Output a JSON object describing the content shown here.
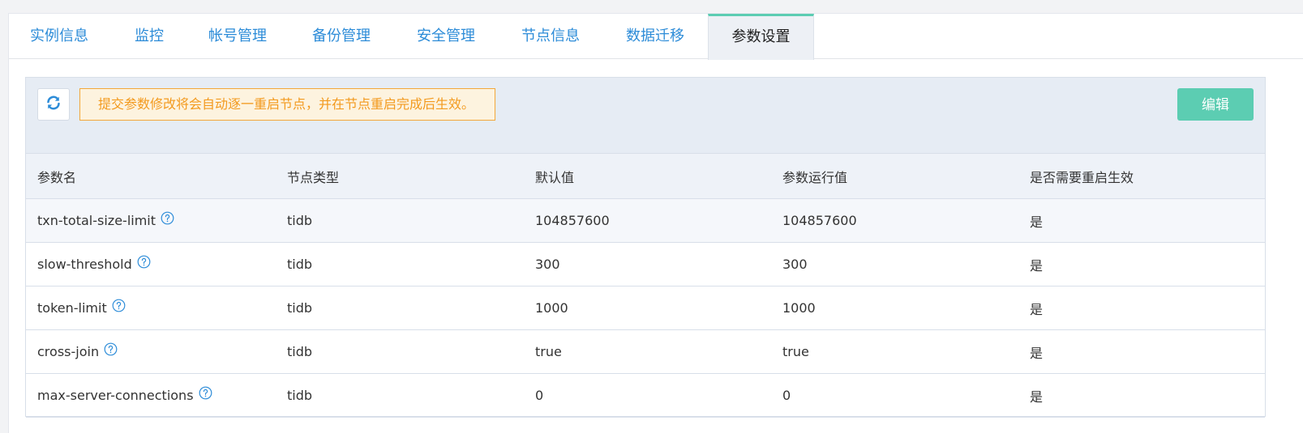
{
  "tabs": [
    {
      "label": "实例信息"
    },
    {
      "label": "监控"
    },
    {
      "label": "帐号管理"
    },
    {
      "label": "备份管理"
    },
    {
      "label": "安全管理"
    },
    {
      "label": "节点信息"
    },
    {
      "label": "数据迁移"
    },
    {
      "label": "参数设置"
    }
  ],
  "active_tab": "参数设置",
  "toolbar": {
    "refresh_icon": "refresh-icon",
    "notice": "提交参数修改将会自动逐一重启节点，并在节点重启完成后生效。",
    "edit_label": "编辑"
  },
  "table": {
    "headers": [
      "参数名",
      "节点类型",
      "默认值",
      "参数运行值",
      "是否需要重启生效"
    ],
    "rows": [
      {
        "name": "txn-total-size-limit",
        "node_type": "tidb",
        "default": "104857600",
        "running": "104857600",
        "restart": "是"
      },
      {
        "name": "slow-threshold",
        "node_type": "tidb",
        "default": "300",
        "running": "300",
        "restart": "是"
      },
      {
        "name": "token-limit",
        "node_type": "tidb",
        "default": "1000",
        "running": "1000",
        "restart": "是"
      },
      {
        "name": "cross-join",
        "node_type": "tidb",
        "default": "true",
        "running": "true",
        "restart": "是"
      },
      {
        "name": "max-server-connections",
        "node_type": "tidb",
        "default": "0",
        "running": "0",
        "restart": "是"
      }
    ]
  },
  "colors": {
    "accent": "#5ccdb2",
    "link": "#2d8cd8",
    "warning": "#f39a1e"
  }
}
